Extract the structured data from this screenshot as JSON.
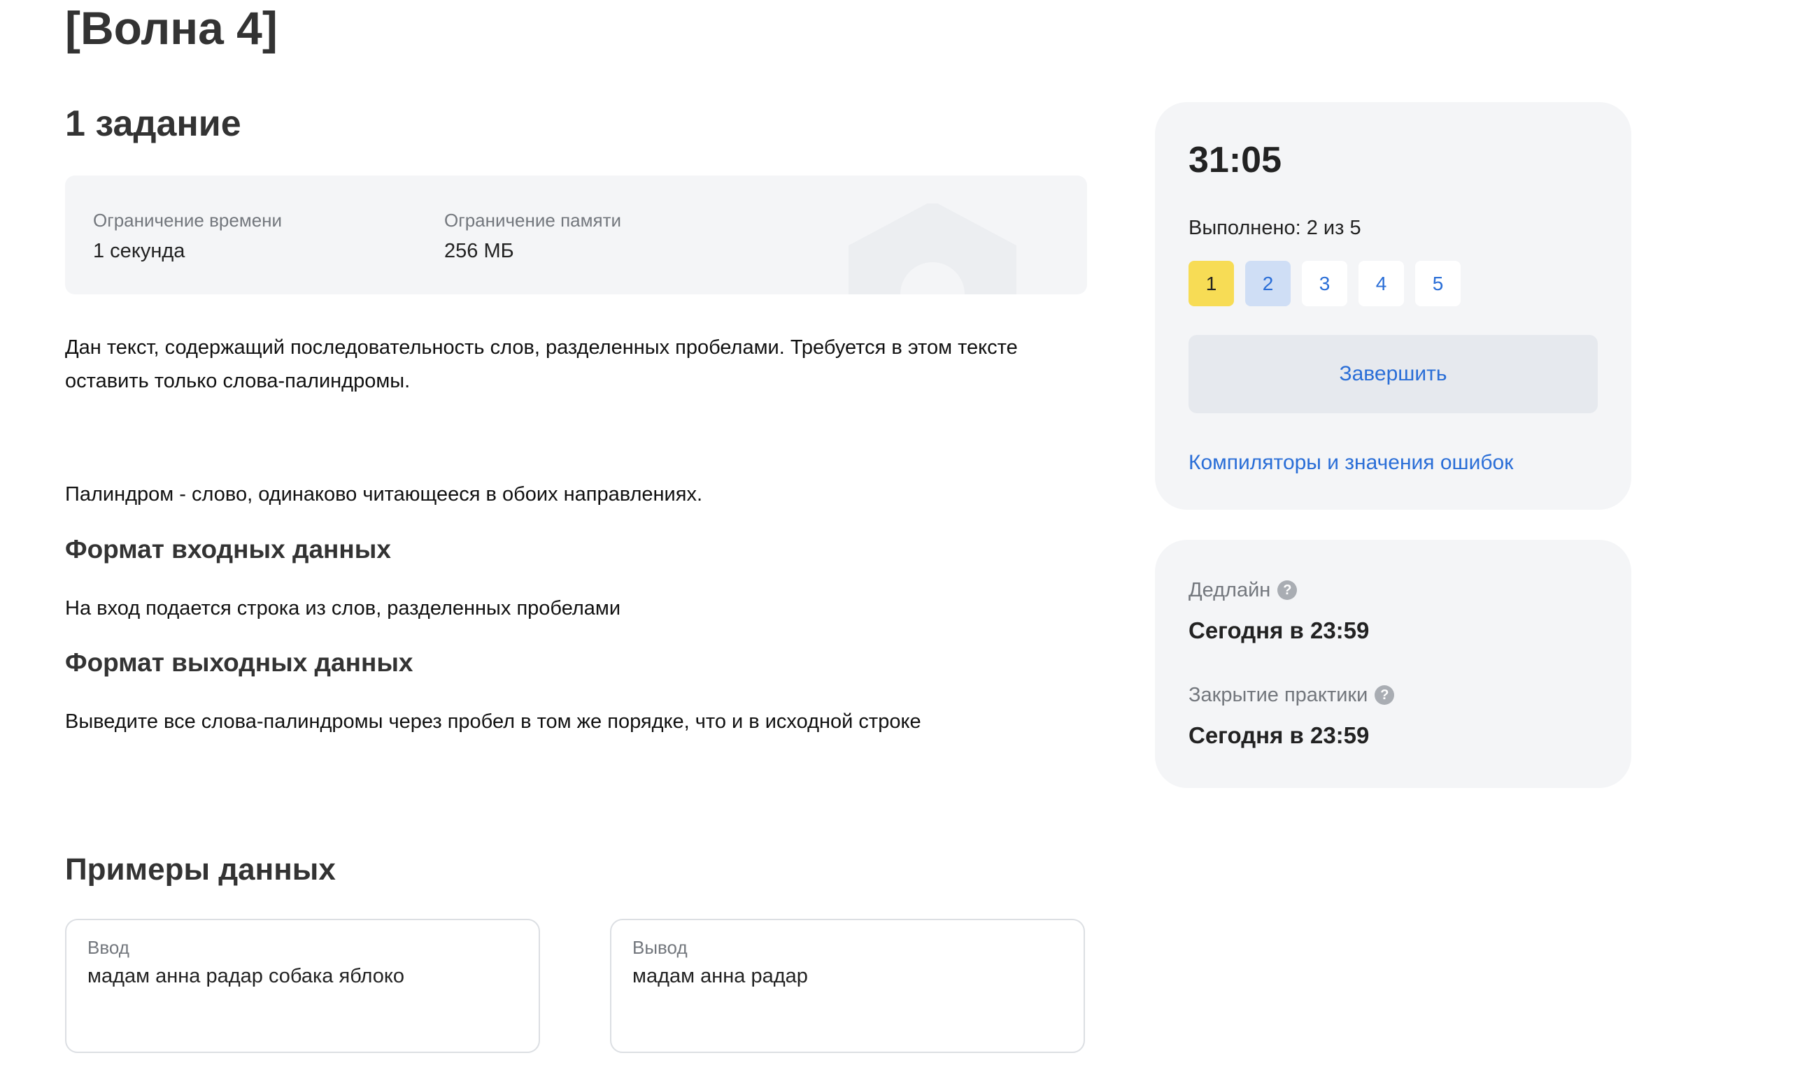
{
  "page": {
    "title": "[Волна 4]"
  },
  "task": {
    "title": "1 задание",
    "limits": {
      "time_label": "Ограничение времени",
      "time_value": "1 секунда",
      "memory_label": "Ограничение памяти",
      "memory_value": "256 МБ"
    },
    "statement_p1": "Дан текст, содержащий последовательность слов, разделенных пробелами. Требуется в этом тексте оставить только слова-палиндромы.",
    "statement_p2": "Палиндром - слово, одинаково читающееся в обоих направлениях.",
    "input_heading": "Формат входных данных",
    "input_text": "На вход подается строка из слов, разделенных пробелами",
    "output_heading": "Формат выходных данных",
    "output_text": "Выведите все слова-палиндромы через пробел в том же порядке, что и в исходной строке"
  },
  "examples": {
    "heading": "Примеры данных",
    "input_label": "Ввод",
    "input_value": "мадам анна радар собака яблоко",
    "output_label": "Вывод",
    "output_value": "мадам анна радар"
  },
  "sidebar": {
    "timer": "31:05",
    "progress": "Выполнено: 2 из 5",
    "tasks": [
      "1",
      "2",
      "3",
      "4",
      "5"
    ],
    "finish_label": "Завершить",
    "compilers_link": "Компиляторы и значения ошибок",
    "deadline_label": "Дедлайн",
    "deadline_value": "Сегодня в 23:59",
    "closing_label": "Закрытие практики",
    "closing_value": "Сегодня в 23:59",
    "help_glyph": "?"
  },
  "colors": {
    "accent": "#2a6ed7",
    "current_task": "#f7dc55",
    "done_task": "#cfdef5",
    "panel_bg": "#f4f5f7"
  },
  "icons": {
    "help": "help-icon",
    "decor": "house-illustration"
  }
}
